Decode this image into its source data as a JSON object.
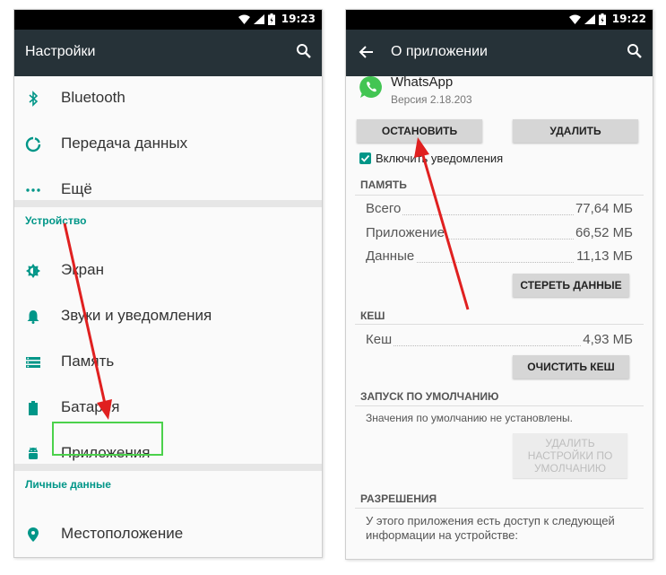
{
  "left": {
    "status_time": "19:23",
    "title": "Настройки",
    "items_top": [
      {
        "label": "Bluetooth",
        "icon": "bluetooth-icon"
      },
      {
        "label": "Передача данных",
        "icon": "data-usage-icon"
      },
      {
        "label": "Ещё",
        "icon": "more-icon"
      }
    ],
    "section_device": "Устройство",
    "items_device": [
      {
        "label": "Экран",
        "icon": "display-icon"
      },
      {
        "label": "Звуки и уведомления",
        "icon": "bell-icon"
      },
      {
        "label": "Память",
        "icon": "storage-icon"
      },
      {
        "label": "Батарея",
        "icon": "battery-icon"
      },
      {
        "label": "Приложения",
        "icon": "android-icon"
      }
    ],
    "section_personal": "Личные данные",
    "items_personal": [
      {
        "label": "Местоположение",
        "icon": "location-icon"
      }
    ]
  },
  "right": {
    "status_time": "19:22",
    "title": "О приложении",
    "app_name": "WhatsApp",
    "app_version": "Версия 2.18.203",
    "stop_button": "ОСТАНОВИТЬ",
    "uninstall_button": "УДАЛИТЬ",
    "notifications_label": "Включить уведомления",
    "notifications_checked": true,
    "memory_title": "ПАМЯТЬ",
    "memory_rows": [
      {
        "key": "Всего",
        "value": "77,64 МБ"
      },
      {
        "key": "Приложение",
        "value": "66,52 МБ"
      },
      {
        "key": "Данные",
        "value": "11,13 МБ"
      }
    ],
    "clear_data_button": "СТЕРЕТЬ ДАННЫЕ",
    "cache_title": "КЕШ",
    "cache_row": {
      "key": "Кеш",
      "value": "4,93 МБ"
    },
    "clear_cache_button": "ОЧИСТИТЬ КЕШ",
    "launch_title": "ЗАПУСК ПО УМОЛЧАНИЮ",
    "launch_text": "Значения по умолчанию не установлены.",
    "clear_defaults_button": "УДАЛИТЬ НАСТРОЙКИ ПО УМОЛЧАНИЮ",
    "permissions_title": "РАЗРЕШЕНИЯ",
    "permissions_text": "У этого приложения есть доступ к следующей информации на устройстве:"
  },
  "colors": {
    "appbar": "#263238",
    "accent": "#009688",
    "highlight": "#4bd14b",
    "arrow": "#e02020",
    "whatsapp": "#43c553"
  }
}
